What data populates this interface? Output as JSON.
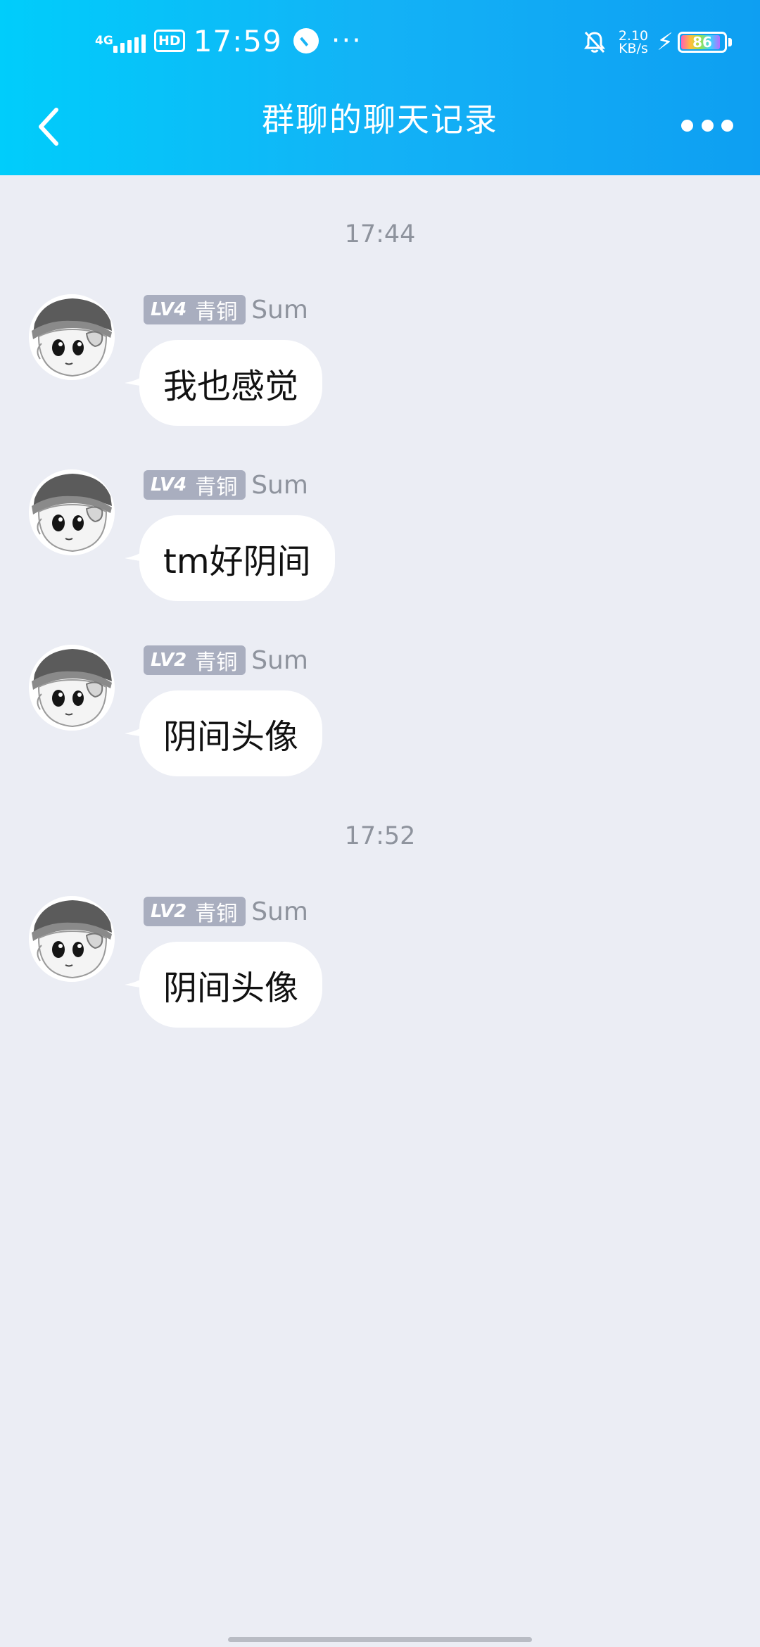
{
  "status_bar": {
    "network": "4G",
    "hd_label": "HD",
    "time": "17:59",
    "more_dots": "···",
    "speed_value": "2.10",
    "speed_unit": "KB/s",
    "battery": "86"
  },
  "nav": {
    "title": "群聊的聊天记录"
  },
  "messages": [
    {
      "timestamp": "17:44",
      "level": "LV4",
      "rank": "青铜",
      "sender": "Sum",
      "text": "我也感觉"
    },
    {
      "level": "LV4",
      "rank": "青铜",
      "sender": "Sum",
      "text": "tm好阴间"
    },
    {
      "level": "LV2",
      "rank": "青铜",
      "sender": "Sum",
      "text": "阴间头像"
    },
    {
      "timestamp": "17:52",
      "level": "LV2",
      "rank": "青铜",
      "sender": "Sum",
      "text": "阴间头像"
    }
  ],
  "icons": {
    "back": "chevron-left-icon",
    "more": "more-dots-icon",
    "avatar": "cartoon-avatar"
  },
  "colors": {
    "header_start": "#00cdfb",
    "header_end": "#0e9ff2",
    "background": "#ebedf4",
    "badge": "#a9aebf"
  }
}
